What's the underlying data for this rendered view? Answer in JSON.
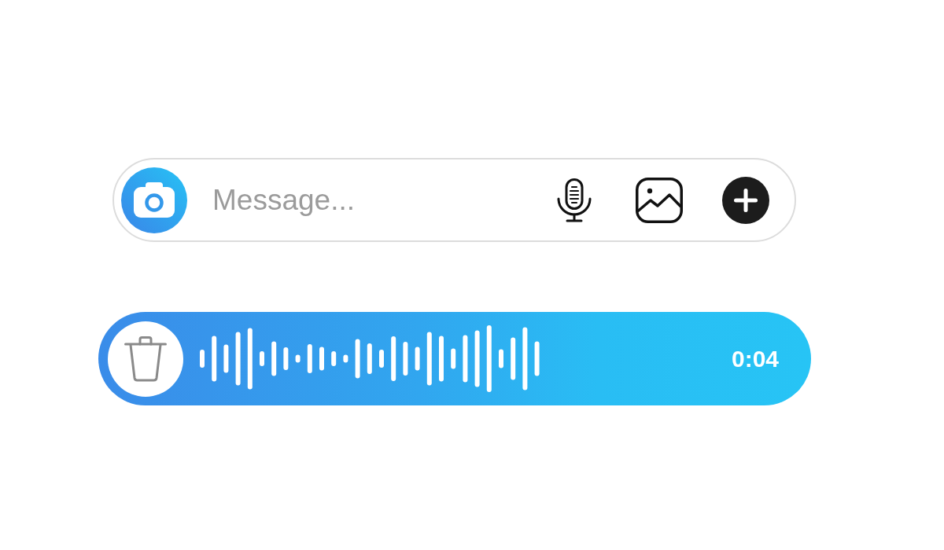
{
  "composer": {
    "placeholder": "Message..."
  },
  "voice_message": {
    "duration": "0:04"
  }
}
